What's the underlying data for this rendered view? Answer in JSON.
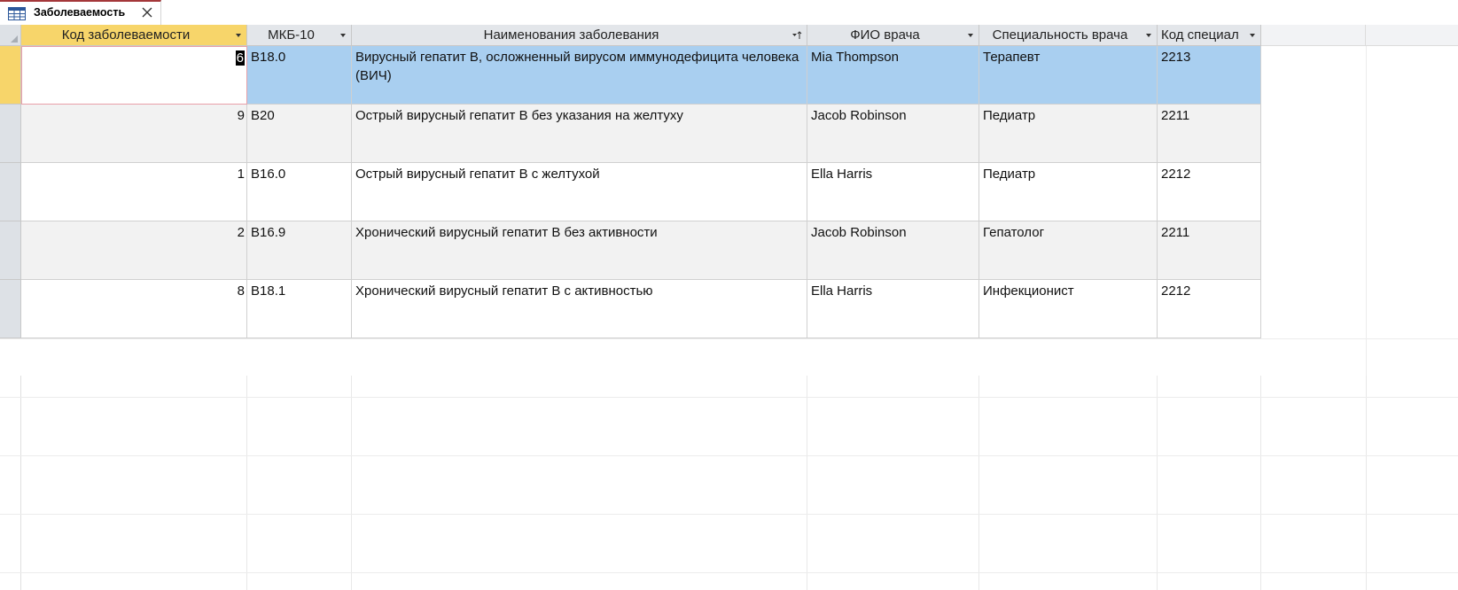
{
  "tab": {
    "title": "Заболеваемость",
    "icon": "table-icon",
    "close_icon": "close-icon"
  },
  "columns": [
    {
      "label": "Код заболеваемости"
    },
    {
      "label": "МКБ-10"
    },
    {
      "label": "Наименования заболевания"
    },
    {
      "label": "ФИО врача"
    },
    {
      "label": "Специальность врача"
    },
    {
      "label": "Код специал"
    }
  ],
  "rows": [
    {
      "id": "6",
      "mkb": "B18.0",
      "name": "Вирусный гепатит B, осложненный вирусом иммунодефицита человека (ВИЧ)",
      "doctor": "Mia Thompson",
      "specialty": "Терапевт",
      "spec_code": "2213"
    },
    {
      "id": "9",
      "mkb": "B20",
      "name": "Острый вирусный гепатит B без указания на желтуху",
      "doctor": "Jacob Robinson",
      "specialty": "Педиатр",
      "spec_code": "2211"
    },
    {
      "id": "1",
      "mkb": "B16.0",
      "name": "Острый вирусный гепатит B с желтухой",
      "doctor": "Ella Harris",
      "specialty": "Педиатр",
      "spec_code": "2212"
    },
    {
      "id": "2",
      "mkb": "B16.9",
      "name": "Хронический вирусный гепатит B без активности",
      "doctor": "Jacob Robinson",
      "specialty": "Гепатолог",
      "spec_code": "2211"
    },
    {
      "id": "8",
      "mkb": "B18.1",
      "name": "Хронический вирусный гепатит B с активностью",
      "doctor": "Ella Harris",
      "specialty": "Инфекционист",
      "spec_code": "2212"
    }
  ],
  "colors": {
    "selected_row": "#a9cff0",
    "active_header": "#f7d56a",
    "tab_accent": "#a4373a"
  }
}
